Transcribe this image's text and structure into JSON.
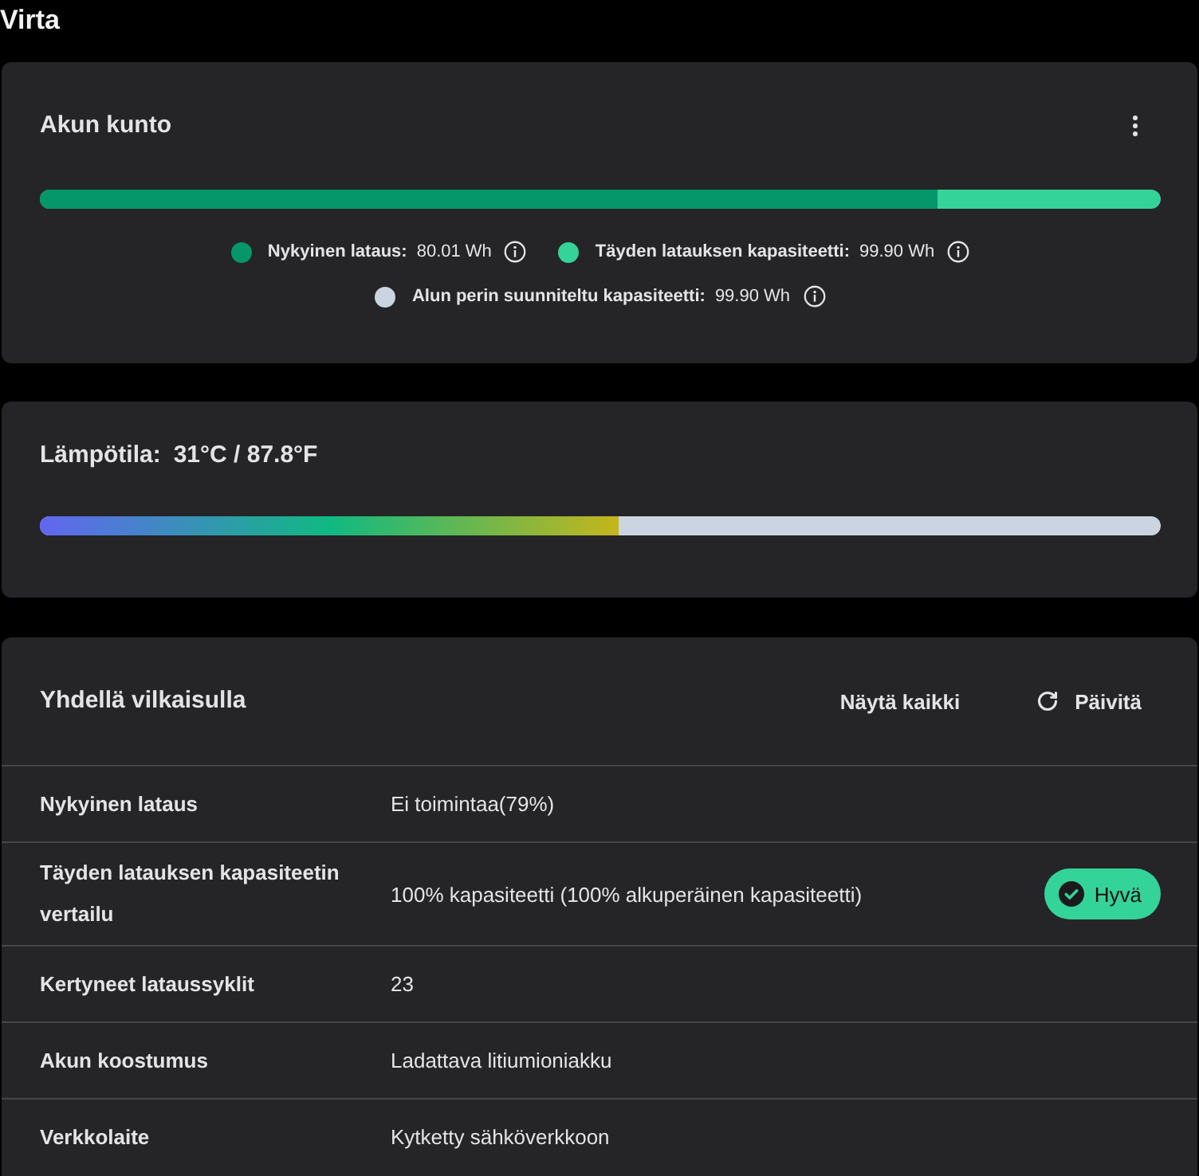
{
  "page": {
    "title": "Virta"
  },
  "health_card": {
    "title": "Akun kunto",
    "bar": {
      "level": 0.8009
    },
    "legend": [
      {
        "label": "Nykyinen lataus:",
        "value": "80.01 Wh",
        "color": "#059669"
      },
      {
        "label": "Täyden latauksen kapasiteetti:",
        "value": "99.90 Wh",
        "color": "#34d399"
      },
      {
        "label": "Alun perin suunniteltu kapasiteetti:",
        "value": "99.90 Wh",
        "color": "#cbd5e1"
      }
    ]
  },
  "temperature_card": {
    "label": "Lämpötila:",
    "value": "31°C / 87.8°F",
    "level": 0.516
  },
  "glance_card": {
    "title": "Yhdellä vilkaisulla",
    "actions": [
      {
        "label": "Näytä kaikki",
        "kind": "text"
      },
      {
        "label": "Päivitä",
        "kind": "refresh"
      }
    ],
    "rows": [
      {
        "label": "Nykyinen lataus",
        "value": "Ei toimintaa(79%)"
      },
      {
        "label": "Täyden latauksen kapasiteetin vertailu",
        "value": "100% kapasiteetti (100% alkuperäinen kapasiteetti)",
        "badge": "Hyvä"
      },
      {
        "label": "Kertyneet lataussyklit",
        "value": "23"
      },
      {
        "label": "Akun koostumus",
        "value": "Ladattava litiumioniakku"
      },
      {
        "label": "Verkkolaite",
        "value": "Kytketty sähköverkkoon"
      }
    ]
  }
}
